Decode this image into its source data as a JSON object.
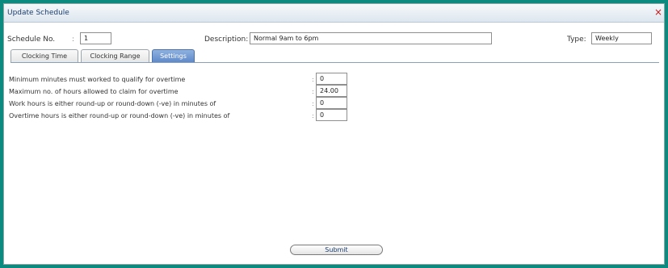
{
  "window": {
    "title": "Update Schedule",
    "close_glyph": "×"
  },
  "header": {
    "schedule_no_label": "Schedule No.",
    "schedule_no_sep": ":",
    "schedule_no_value": "1",
    "description_label": "Description:",
    "description_value": "Normal 9am to 6pm",
    "type_label": "Type:",
    "type_value": "Weekly"
  },
  "tabs": [
    {
      "label": "Clocking Time",
      "active": false
    },
    {
      "label": "Clocking Range",
      "active": false
    },
    {
      "label": "Settings",
      "active": true
    }
  ],
  "settings": {
    "rows": [
      {
        "label": "Minimum minutes must worked to qualify for overtime",
        "sep": ":",
        "value": "0"
      },
      {
        "label": "Maximum no. of hours allowed to claim for overtime",
        "sep": ":",
        "value": "24.00"
      },
      {
        "label": "Work hours is either round-up or round-down (-ve) in minutes of",
        "sep": ":",
        "value": "0"
      },
      {
        "label": "Overtime hours is either round-up or round-down (-ve) in minutes of",
        "sep": ":",
        "value": "0"
      }
    ]
  },
  "actions": {
    "submit_label": "Submit"
  },
  "colors": {
    "frame": "#0b8a80",
    "active_tab": "#6f97d3",
    "close": "#c21a1a"
  }
}
